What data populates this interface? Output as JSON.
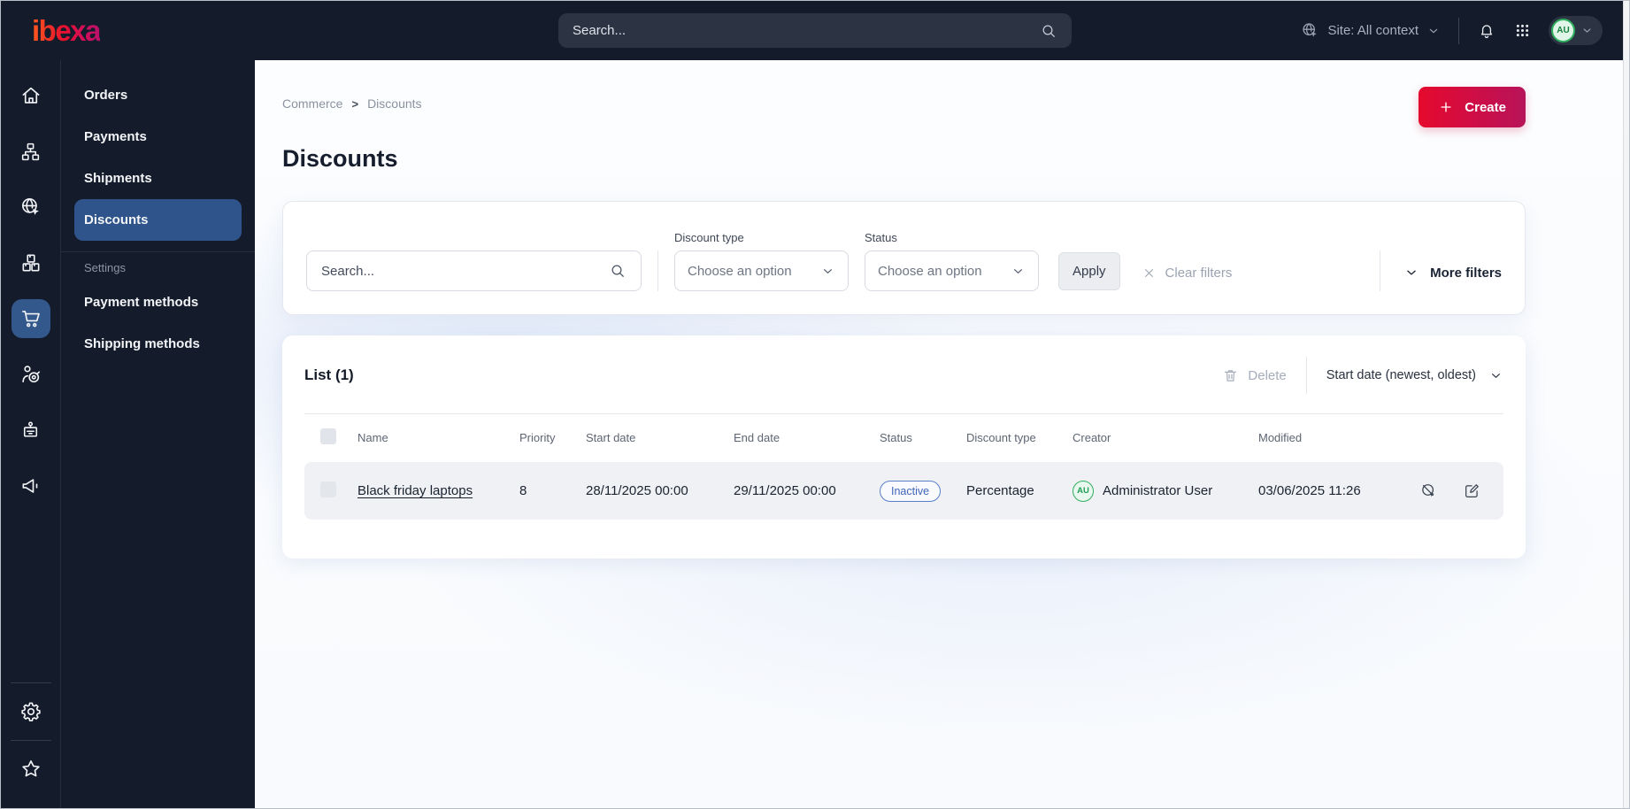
{
  "colors": {
    "topbar_bg": "#141b2a",
    "active_blue": "#2f548b",
    "brand_gradient": [
      "#ff5a1f",
      "#e8112d",
      "#b5126b"
    ],
    "create_gradient": [
      "#e5092d",
      "#b71459"
    ],
    "badge_blue": "#4065ba",
    "avatar_green": "#2fae5e"
  },
  "topbar": {
    "logo_text": "ibexa",
    "search_placeholder": "Search...",
    "site_selector": "Site: All context",
    "avatar_initials": "AU"
  },
  "sidebar": {
    "items": [
      {
        "label": "Orders"
      },
      {
        "label": "Payments"
      },
      {
        "label": "Shipments"
      },
      {
        "label": "Discounts"
      }
    ],
    "section_label": "Settings",
    "section_items": [
      {
        "label": "Payment methods"
      },
      {
        "label": "Shipping methods"
      }
    ]
  },
  "main": {
    "breadcrumb": {
      "items": [
        "Commerce",
        "Discounts"
      ],
      "separator": ">"
    },
    "create_button": "Create",
    "page_title": "Discounts",
    "filters": {
      "search_placeholder": "Search...",
      "discount_type": {
        "label": "Discount type",
        "value": "Choose an option"
      },
      "status": {
        "label": "Status",
        "value": "Choose an option"
      },
      "apply_button": "Apply",
      "clear_filters": "Clear filters",
      "more_filters": "More filters"
    },
    "list": {
      "title": "List (1)",
      "delete_button": "Delete",
      "sort_selector": "Start date (newest, oldest)",
      "columns": [
        "Name",
        "Priority",
        "Start date",
        "End date",
        "Status",
        "Discount type",
        "Creator",
        "Modified"
      ],
      "rows": [
        {
          "name": "Black friday laptops",
          "priority": "8",
          "start_date": "28/11/2025 00:00",
          "end_date": "29/11/2025 00:00",
          "status": "Inactive",
          "discount_type": "Percentage",
          "creator": {
            "initials": "AU",
            "name": "Administrator User"
          },
          "modified": "03/06/2025 11:26"
        }
      ]
    }
  }
}
